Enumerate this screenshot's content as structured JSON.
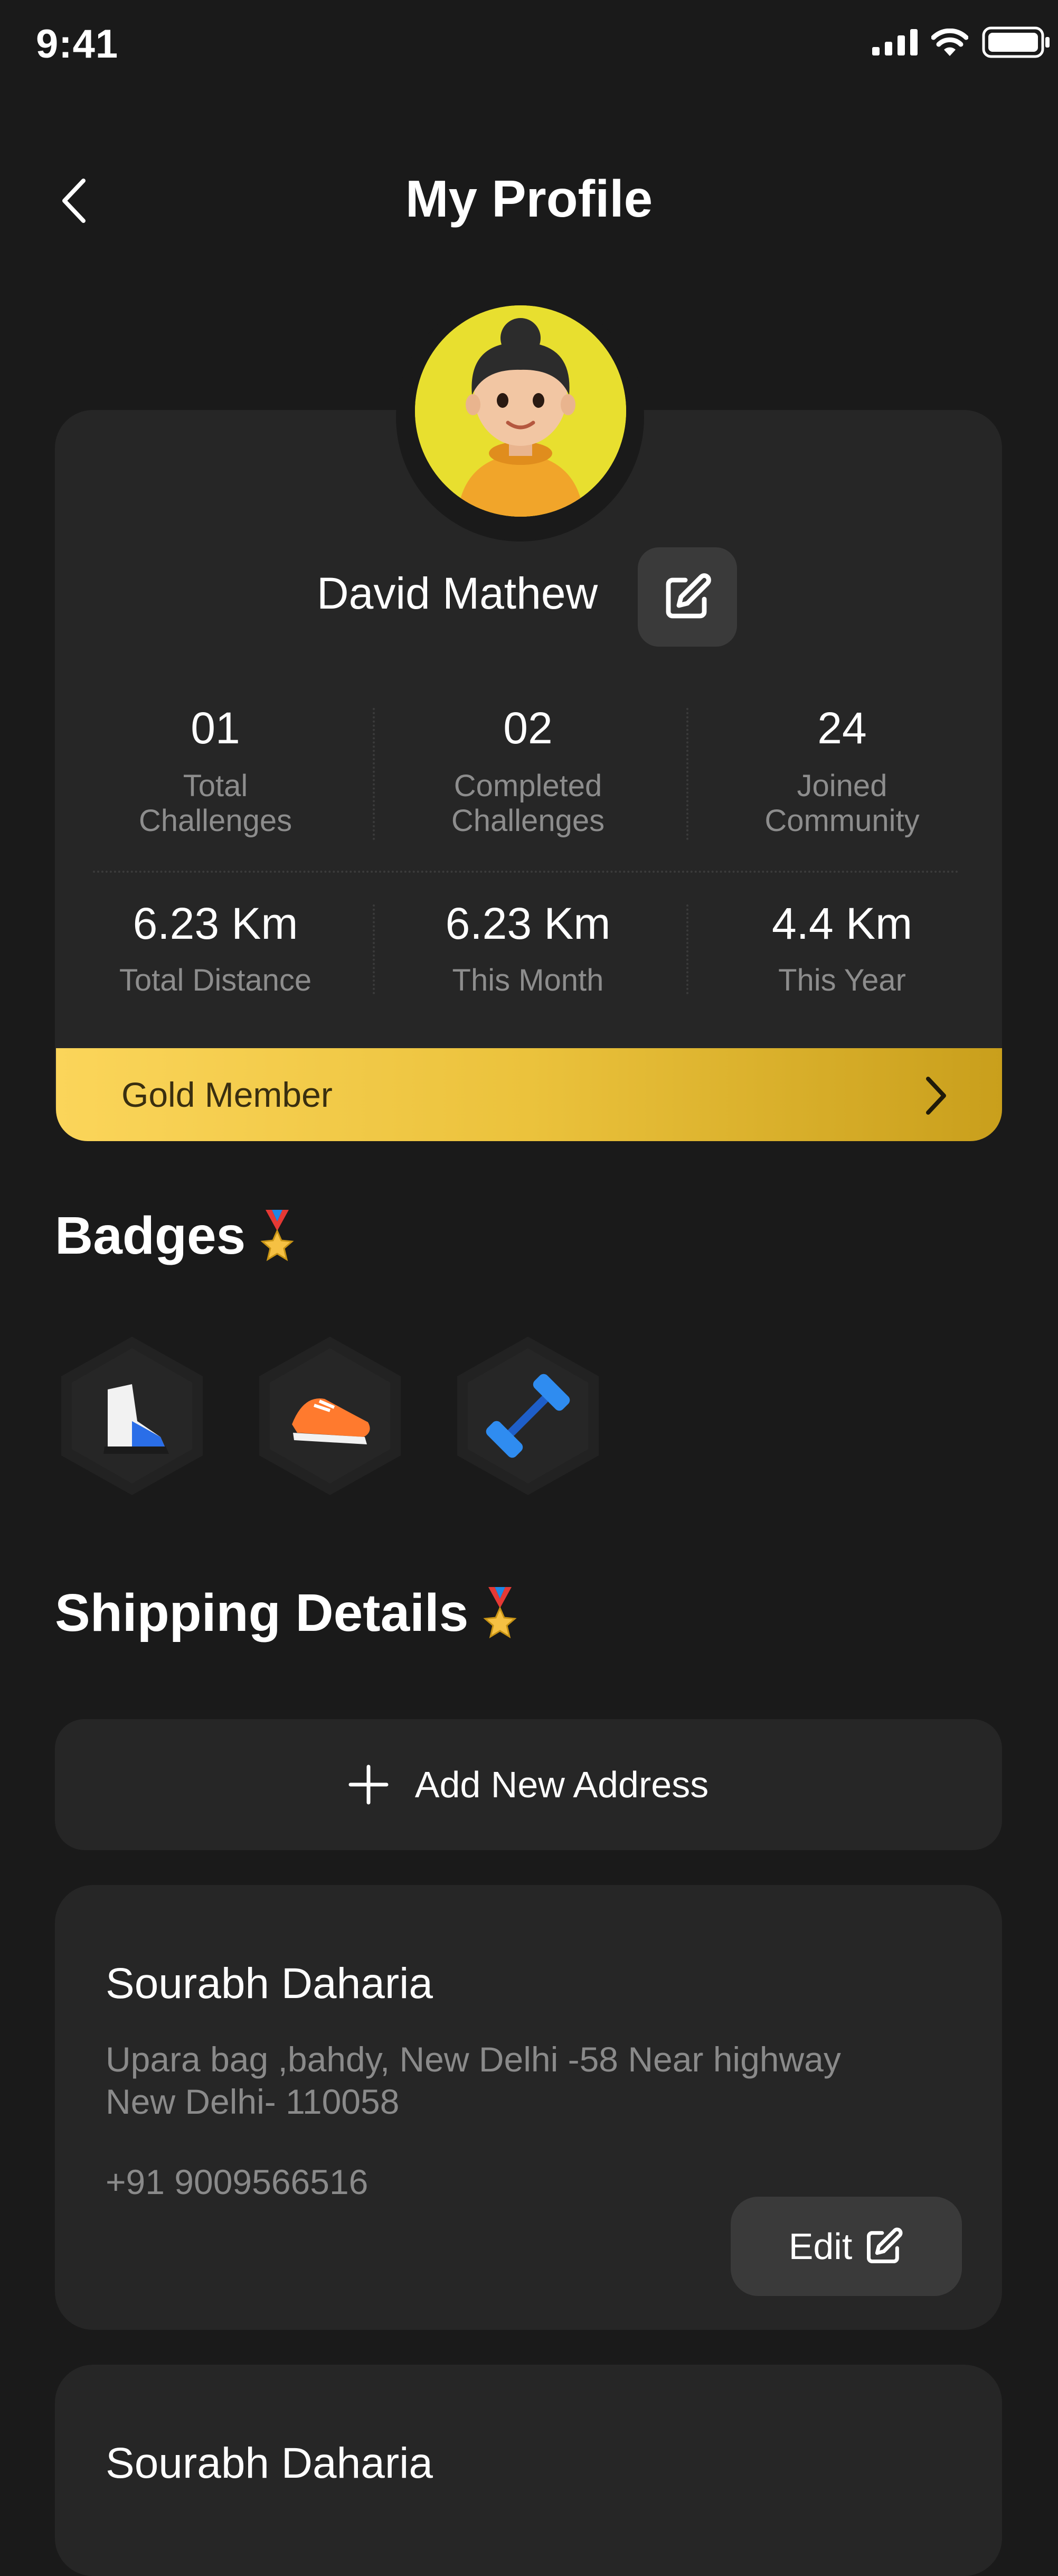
{
  "status_bar": {
    "time": "9:41"
  },
  "header": {
    "title": "My Profile"
  },
  "profile": {
    "name": "David Mathew",
    "stats_top": [
      {
        "value": "01",
        "label_line1": "Total",
        "label_line2": "Challenges"
      },
      {
        "value": "02",
        "label_line1": "Completed",
        "label_line2": "Challenges"
      },
      {
        "value": "24",
        "label_line1": "Joined",
        "label_line2": "Community"
      }
    ],
    "stats_bottom": [
      {
        "value": "6.23 Km",
        "label": "Total Distance"
      },
      {
        "value": "6.23 Km",
        "label": "This Month"
      },
      {
        "value": "4.4 Km",
        "label": "This Year"
      }
    ],
    "membership": "Gold Member"
  },
  "badges": {
    "title": "Badges",
    "items": [
      "sneaker-blue-icon",
      "running-shoe-orange-icon",
      "dumbbell-blue-icon"
    ]
  },
  "shipping": {
    "title": "Shipping Details",
    "add_label": "Add New Address",
    "addresses": [
      {
        "name": "Sourabh Daharia",
        "line1": "Upara bag ,bahdy, New Delhi -58 Near highway",
        "line2": "New Delhi- 110058",
        "phone": "+91 9009566516",
        "edit_label": "Edit"
      },
      {
        "name": "Sourabh Daharia"
      }
    ]
  },
  "colors": {
    "background": "#1a1a1a",
    "card": "#262626",
    "gold_start": "#fbd55a",
    "gold_end": "#c99f1c",
    "avatar_bg": "#e8df2f"
  }
}
